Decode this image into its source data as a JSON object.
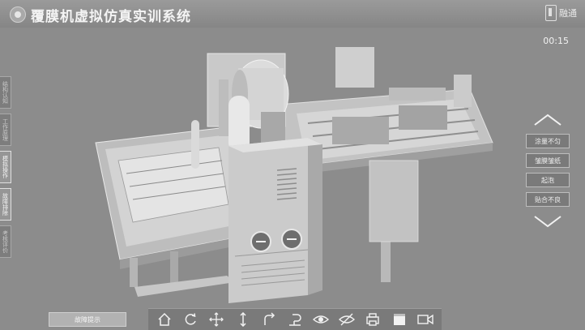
{
  "app": {
    "title": "覆膜机虚拟仿真实训系统",
    "logo_text": "融通",
    "timer": "00:15"
  },
  "left_tabs": [
    {
      "label": "结构认知",
      "active": false
    },
    {
      "label": "工作原理",
      "active": false
    },
    {
      "label": "模拟操作",
      "active": true
    },
    {
      "label": "故障排除",
      "active": true
    },
    {
      "label": "考核评价",
      "active": false
    }
  ],
  "faults": [
    "涂量不匀",
    "皱膜皱纸",
    "起泡",
    "贴合不良"
  ],
  "hint_button": "故障提示",
  "toolbar": {
    "icons": [
      "home-icon",
      "rotate-icon",
      "move-icon",
      "vertical-move-icon",
      "reset-icon",
      "undo-icon",
      "show-icon",
      "hide-icon",
      "print-icon",
      "screen-icon",
      "camera-icon"
    ]
  },
  "colors": {
    "background": "#8c8c8c",
    "machine": "#cfcfcf"
  }
}
